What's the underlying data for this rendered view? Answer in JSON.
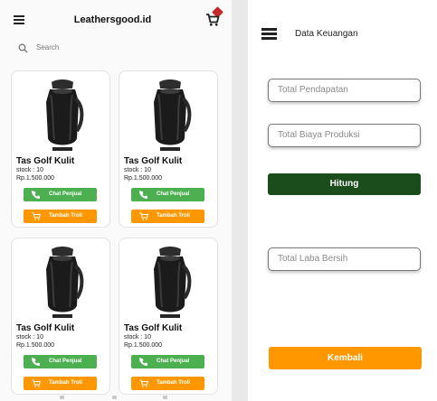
{
  "products_screen": {
    "title": "Leathersgood.id",
    "search_placeholder": "Search",
    "products": [
      {
        "name": "Tas Golf Kulit",
        "stock": "stock : 10",
        "price": "Rp.1.500.000",
        "chat_label": "Chat Penjual",
        "cart_label": "Tambah Troli"
      },
      {
        "name": "Tas Golf Kulit",
        "stock": "stock : 10",
        "price": "Rp.1.500.000",
        "chat_label": "Chat Penjual",
        "cart_label": "Tambah Troli"
      },
      {
        "name": "Tas Golf Kulit",
        "stock": "stock : 10",
        "price": "Rp.1.500.000",
        "chat_label": "Chat Penjual",
        "cart_label": "Tambah Troli"
      },
      {
        "name": "Tas Golf Kulit",
        "stock": "stock : 10",
        "price": "Rp.1.500.000",
        "chat_label": "Chat Penjual",
        "cart_label": "Tambah Troli"
      }
    ],
    "icons": {
      "menu": "hamburger-menu-icon",
      "cart": "shopping-cart-icon",
      "search": "search-icon",
      "phone": "phone-icon",
      "cart_add": "cart-add-icon"
    }
  },
  "finance_screen": {
    "title": "Data Keuangan",
    "fields": {
      "total_pendapatan": "Total Pendapatan",
      "total_biaya_produksi": "Total Biaya Produksi",
      "total_laba_bersih": "Total Laba Bersih"
    },
    "hitung_label": "Hitung",
    "kembali_label": "Kembali"
  },
  "colors": {
    "chat_button": "#4caf50",
    "cart_button": "#ff9800",
    "hitung_button": "#1b4d1c",
    "kembali_button": "#ff9800",
    "cart_badge": "#c62828"
  }
}
